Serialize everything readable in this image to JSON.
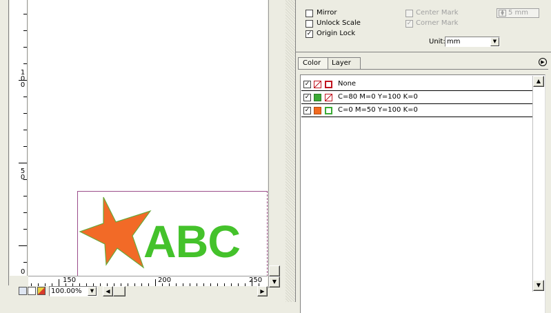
{
  "ruler": {
    "v_labels": [
      "100",
      "50",
      "0"
    ],
    "h_labels": [
      "150",
      "200",
      "250"
    ]
  },
  "artwork": {
    "text": "ABC",
    "text_color": "#44c22b",
    "star_color": "#f26a27",
    "star_stroke": "#6aa83a",
    "frame_color": "#9b4c8a"
  },
  "statusbar": {
    "zoom": "100.00%"
  },
  "print_options": {
    "mirror": {
      "label": "Mirror",
      "checked": false
    },
    "unlock_scale": {
      "label": "Unlock Scale",
      "checked": false
    },
    "origin_lock": {
      "label": "Origin Lock",
      "checked": true
    },
    "center_mark": {
      "label": "Center Mark",
      "checked": false,
      "enabled": false
    },
    "corner_mark": {
      "label": "Corner Mark",
      "checked": true,
      "enabled": false
    },
    "mark_size": "5 mm",
    "unit_label": "Unit:",
    "unit_value": "mm"
  },
  "panel": {
    "tabs": [
      "Color",
      "Layer"
    ],
    "active_tab": "Color",
    "colors": [
      {
        "name": "None",
        "checked": true,
        "fill": "none",
        "stroke": "#c0121e"
      },
      {
        "name": "C=80 M=0 Y=100 K=0",
        "checked": true,
        "fill": "#3aaa35",
        "stroke": "none"
      },
      {
        "name": "C=0 M=50 Y=100 K=0",
        "checked": true,
        "fill": "#f26a1f",
        "stroke": "#3aaa35"
      }
    ]
  },
  "glyphs": {
    "check": "✓",
    "arrow_up": "▲",
    "arrow_down": "▼",
    "arrow_left": "◀",
    "arrow_right": "▶",
    "menu": "▶"
  }
}
